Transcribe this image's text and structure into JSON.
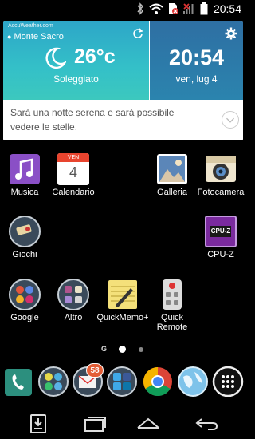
{
  "status_bar": {
    "time": "20:54",
    "icons": [
      "bluetooth-icon",
      "wifi-icon",
      "sim-missing-icon",
      "signal-off-icon",
      "battery-icon"
    ]
  },
  "weather_widget": {
    "provider": "AccuWeather.com",
    "location": "Monte Sacro",
    "temperature": "26°c",
    "condition": "Soleggiato",
    "time": "20:54",
    "date": "ven, lug 4",
    "forecast_text": "Sarà una notte serena e sarà possibile vedere le stelle.",
    "colors": {
      "weather_bg": "#34b6c8",
      "clock_bg": "#2b79a8"
    }
  },
  "apps": {
    "musica": "Musica",
    "calendario": "Calendario",
    "calendar_month": "VEN",
    "calendar_day": "4",
    "galleria": "Galleria",
    "fotocamera": "Fotocamera",
    "giochi": "Giochi",
    "cpuz": "CPU-Z",
    "cpuz_icon_text": "CPU-Z",
    "google": "Google",
    "altro": "Altro",
    "quickmemo": "QuickMemo+",
    "quickremote": "Quick Remote"
  },
  "pager": {
    "google_label": "G",
    "active_page": 1,
    "page_count": 2
  },
  "dock": {
    "badge_count": "58",
    "items": [
      "phone-icon",
      "messaging-folder-icon",
      "email-folder-icon",
      "social-folder-icon",
      "chrome-icon",
      "browser-icon",
      "app-drawer-icon"
    ]
  },
  "navbar": {
    "items": [
      "notification-download-icon",
      "recents-icon",
      "home-icon",
      "back-icon"
    ]
  }
}
